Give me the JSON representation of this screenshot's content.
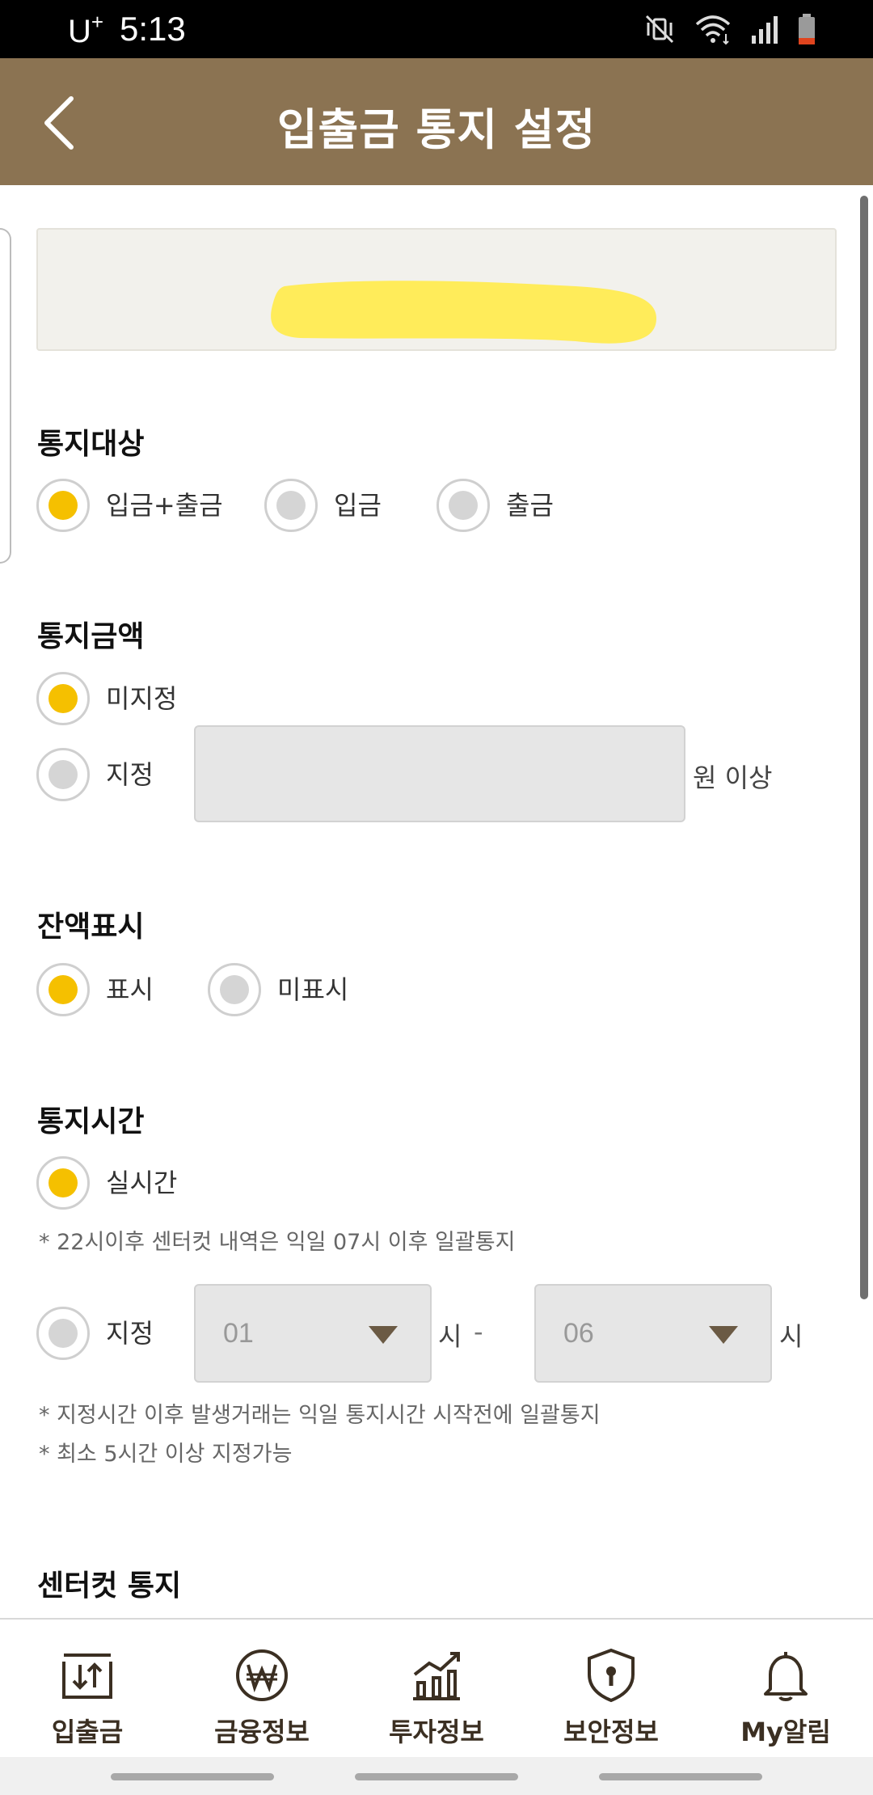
{
  "status_bar": {
    "carrier": "U",
    "carrier_plus": "+",
    "time": "5:13"
  },
  "header": {
    "title": "입출금 통지 설정"
  },
  "account": {
    "masked": true
  },
  "notify_target": {
    "title": "통지대상",
    "options": [
      {
        "label": "입금+출금",
        "checked": true
      },
      {
        "label": "입금",
        "checked": false
      },
      {
        "label": "출금",
        "checked": false
      }
    ]
  },
  "notify_amount": {
    "title": "통지금액",
    "unset_label": "미지정",
    "unset_checked": true,
    "set_label": "지정",
    "set_checked": false,
    "amount_value": "",
    "unit": "원 이상"
  },
  "balance_display": {
    "title": "잔액표시",
    "options": [
      {
        "label": "표시",
        "checked": true
      },
      {
        "label": "미표시",
        "checked": false
      }
    ]
  },
  "notify_time": {
    "title": "통지시간",
    "realtime_label": "실시간",
    "realtime_checked": true,
    "realtime_note": "* 22시이후 센터컷 내역은 익일 07시 이후 일괄통지",
    "custom_label": "지정",
    "custom_checked": false,
    "start_hour": "01",
    "end_hour": "06",
    "hour_unit": "시",
    "range_dash": "-",
    "notes": [
      "* 지정시간 이후 발생거래는 익일 통지시간 시작전에 일괄통지",
      "* 최소 5시간 이상 지정가능"
    ]
  },
  "center_cut": {
    "title": "센터컷 통지"
  },
  "bottom_nav": {
    "items": [
      {
        "label": "입출금",
        "icon": "transfer-arrows-icon"
      },
      {
        "label": "금융정보",
        "icon": "won-coin-icon"
      },
      {
        "label": "투자정보",
        "icon": "chart-icon"
      },
      {
        "label": "보안정보",
        "icon": "shield-lock-icon"
      },
      {
        "label": "My알림",
        "icon": "bell-icon"
      }
    ]
  },
  "colors": {
    "header_bg": "#8b7352",
    "radio_checked": "#f5c000",
    "radio_unchecked": "#d5d5d5",
    "mask_yellow": "#ffec5a",
    "nav_text": "#3b2f22"
  }
}
